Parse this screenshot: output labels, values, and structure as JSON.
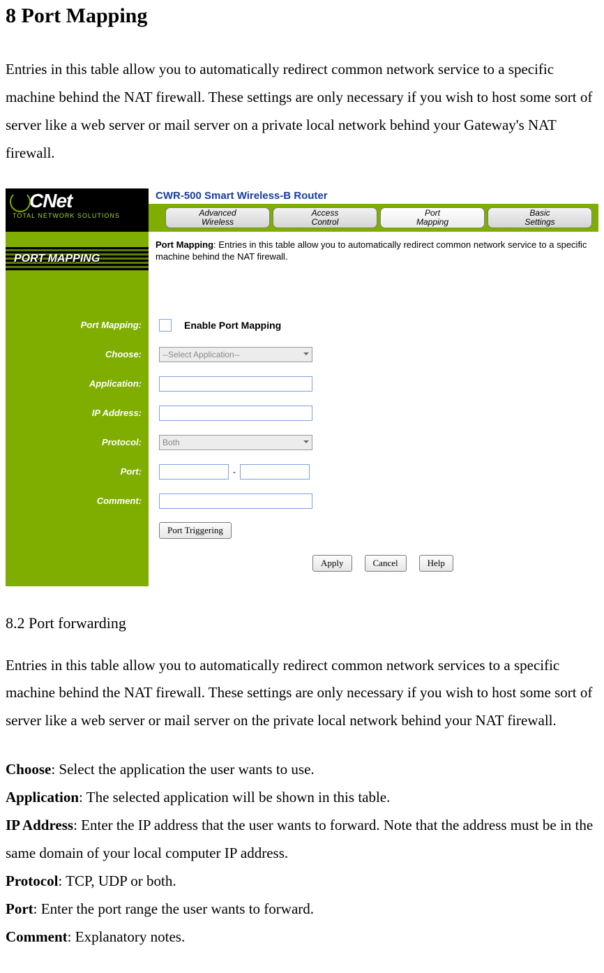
{
  "heading": "8    Port Mapping",
  "intro": "Entries in this table allow you to automatically redirect common network service to a specific machine behind the NAT firewall. These settings are only necessary if you wish to host some sort of server like a web server or mail server on a private local network behind your Gateway's NAT firewall.",
  "screenshot": {
    "logo_brand": "CNet",
    "logo_tag": "TOTAL NETWORK SOLUTIONS",
    "product_title": "CWR-500 Smart Wireless-B Router",
    "tabs": [
      {
        "line1": "Advanced",
        "line2": "Wireless"
      },
      {
        "line1": "Access",
        "line2": "Control"
      },
      {
        "line1": "Port",
        "line2": "Mapping"
      },
      {
        "line1": "Basic",
        "line2": "Settings"
      }
    ],
    "section_title": "PORT MAPPING",
    "desc_label": "Port Mapping",
    "desc_text": ": Entries in this table allow you to automatically redirect common network service to a specific machine behind the NAT firewall.",
    "labels": {
      "port_mapping": "Port Mapping:",
      "choose": "Choose:",
      "application": "Application:",
      "ip": "IP Address:",
      "protocol": "Protocol:",
      "port": "Port:",
      "comment": "Comment:"
    },
    "fields": {
      "enable_label": "Enable Port Mapping",
      "choose_placeholder": "--Select Application--",
      "protocol_value": "Both",
      "port_sep": "-",
      "port_trigger_btn": "Port Triggering"
    },
    "actions": {
      "apply": "Apply",
      "cancel": "Cancel",
      "help": "Help"
    }
  },
  "sub_heading": "8.2 Port forwarding",
  "sub_para": "Entries in this table allow you to automatically redirect common network services to a specific machine behind the NAT firewall. These settings are only necessary if you wish to host some sort of server like a web server or mail server on the private local network behind your NAT firewall.",
  "defs": {
    "choose_l": "Choose",
    "choose_t": ": Select the application the user wants to use.",
    "app_l": "Application",
    "app_t": ": The selected application will be shown in this table.",
    "ip_l": "IP Address",
    "ip_t": ": Enter the IP address that the user wants to forward. Note that the address must be in the same domain of your local computer IP address.",
    "proto_l": "Protocol",
    "proto_t": ": TCP, UDP or both.",
    "port_l": "Port",
    "port_t": ": Enter the port range the user wants to forward.",
    "comment_l": "Comment",
    "comment_t": ": Explanatory notes."
  }
}
